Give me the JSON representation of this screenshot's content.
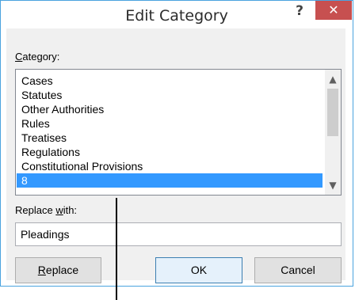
{
  "window": {
    "title": "Edit Category",
    "help_label": "?",
    "close_label": "✕"
  },
  "category": {
    "label_accel": "C",
    "label_rest": "ategory:",
    "items": [
      "Cases",
      "Statutes",
      "Other Authorities",
      "Rules",
      "Treatises",
      "Regulations",
      "Constitutional Provisions",
      "8"
    ],
    "selected_index": 7
  },
  "scroll": {
    "up_icon": "▲",
    "down_icon": "▼"
  },
  "replace_with": {
    "label_prefix": "Replace ",
    "label_accel": "w",
    "label_rest": "ith:",
    "value": "Pleadings"
  },
  "buttons": {
    "replace_accel": "R",
    "replace_rest": "eplace",
    "ok": "OK",
    "cancel": "Cancel"
  },
  "colors": {
    "selection": "#3399ff",
    "close_button": "#c75050",
    "window_border": "#4aa3df"
  }
}
